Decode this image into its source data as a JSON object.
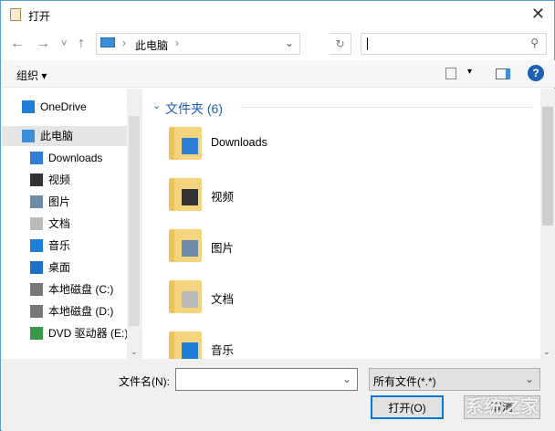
{
  "window": {
    "title": "打开",
    "close": "✕"
  },
  "nav": {
    "back": "←",
    "forward": "→",
    "recent": "˅",
    "up": "↑",
    "path": "此电脑",
    "sep": "›",
    "refresh": "↻",
    "search_placeholder": ""
  },
  "toolbar": {
    "organize": "组织 ▾",
    "help": "?"
  },
  "sidebar": {
    "items": [
      {
        "label": "OneDrive",
        "icon": "cloud-icon"
      },
      {
        "label": "此电脑",
        "icon": "computer-icon",
        "selected": true
      },
      {
        "label": "Downloads",
        "icon": "download-icon"
      },
      {
        "label": "视频",
        "icon": "video-icon"
      },
      {
        "label": "图片",
        "icon": "picture-icon"
      },
      {
        "label": "文档",
        "icon": "document-icon"
      },
      {
        "label": "音乐",
        "icon": "music-icon"
      },
      {
        "label": "桌面",
        "icon": "desktop-icon"
      },
      {
        "label": "本地磁盘 (C:)",
        "icon": "drive-icon"
      },
      {
        "label": "本地磁盘 (D:)",
        "icon": "drive-icon"
      },
      {
        "label": "DVD 驱动器 (E:)",
        "icon": "dvd-icon"
      }
    ]
  },
  "main": {
    "group_header": "文件夹 (6)",
    "folders": [
      "Downloads",
      "视频",
      "图片",
      "文档",
      "音乐"
    ]
  },
  "bottom": {
    "filename_label": "文件名(N):",
    "filename_value": "",
    "filetype": "所有文件(*.*)",
    "open": "打开(O)",
    "cancel": "取消"
  },
  "watermark": "系统之家",
  "colors": {
    "accent": "#1e5fb4",
    "selected": "#e5e5e5",
    "folder": "#f4d47c"
  }
}
